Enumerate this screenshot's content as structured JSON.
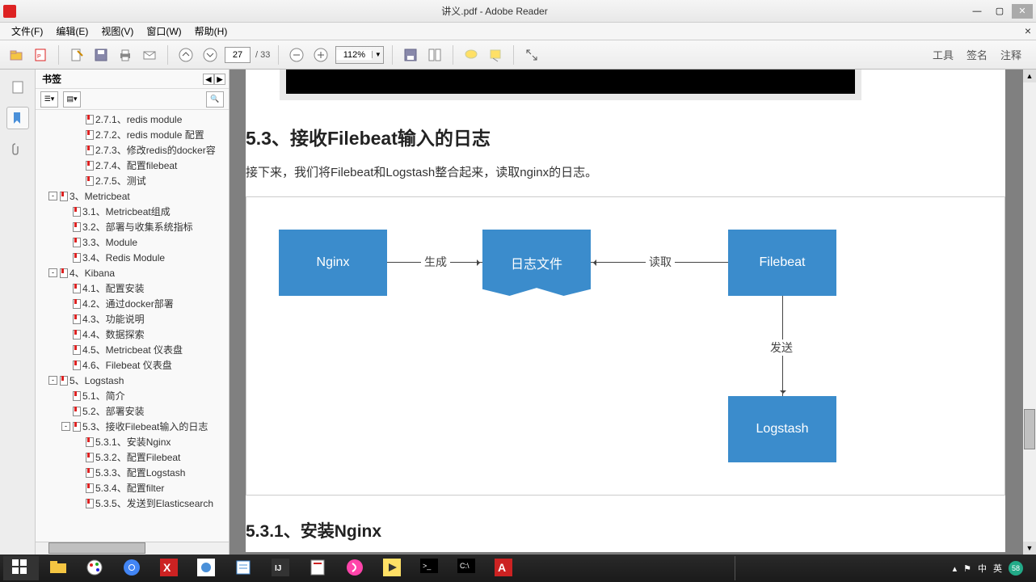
{
  "window": {
    "title": "讲义.pdf - Adobe Reader"
  },
  "menu": {
    "file": "文件(F)",
    "edit": "编辑(E)",
    "view": "视图(V)",
    "window": "窗口(W)",
    "help": "帮助(H)"
  },
  "toolbar": {
    "page_current": "27",
    "page_total": "/ 33",
    "zoom": "112%",
    "tools": "工具",
    "sign": "签名",
    "comment": "注释"
  },
  "sidebar": {
    "title": "书签"
  },
  "bookmarks": [
    {
      "indent": 3,
      "label": "2.7.1、redis module",
      "toggle": ""
    },
    {
      "indent": 3,
      "label": "2.7.2、redis module 配置",
      "toggle": ""
    },
    {
      "indent": 3,
      "label": "2.7.3、修改redis的docker容",
      "toggle": ""
    },
    {
      "indent": 3,
      "label": "2.7.4、配置filebeat",
      "toggle": ""
    },
    {
      "indent": 3,
      "label": "2.7.5、测试",
      "toggle": ""
    },
    {
      "indent": 1,
      "label": "3、Metricbeat",
      "toggle": "-"
    },
    {
      "indent": 2,
      "label": "3.1、Metricbeat组成",
      "toggle": ""
    },
    {
      "indent": 2,
      "label": "3.2、部署与收集系统指标",
      "toggle": ""
    },
    {
      "indent": 2,
      "label": "3.3、Module",
      "toggle": ""
    },
    {
      "indent": 2,
      "label": "3.4、Redis Module",
      "toggle": ""
    },
    {
      "indent": 1,
      "label": "4、Kibana",
      "toggle": "-"
    },
    {
      "indent": 2,
      "label": "4.1、配置安装",
      "toggle": ""
    },
    {
      "indent": 2,
      "label": "4.2、通过docker部署",
      "toggle": ""
    },
    {
      "indent": 2,
      "label": "4.3、功能说明",
      "toggle": ""
    },
    {
      "indent": 2,
      "label": "4.4、数据探索",
      "toggle": ""
    },
    {
      "indent": 2,
      "label": "4.5、Metricbeat 仪表盘",
      "toggle": ""
    },
    {
      "indent": 2,
      "label": "4.6、Filebeat 仪表盘",
      "toggle": ""
    },
    {
      "indent": 1,
      "label": "5、Logstash",
      "toggle": "-"
    },
    {
      "indent": 2,
      "label": "5.1、简介",
      "toggle": ""
    },
    {
      "indent": 2,
      "label": "5.2、部署安装",
      "toggle": ""
    },
    {
      "indent": 2,
      "label": "5.3、接收Filebeat输入的日志",
      "toggle": "-"
    },
    {
      "indent": 3,
      "label": "5.3.1、安装Nginx",
      "toggle": ""
    },
    {
      "indent": 3,
      "label": "5.3.2、配置Filebeat",
      "toggle": ""
    },
    {
      "indent": 3,
      "label": "5.3.3、配置Logstash",
      "toggle": ""
    },
    {
      "indent": 3,
      "label": "5.3.4、配置filter",
      "toggle": ""
    },
    {
      "indent": 3,
      "label": "5.3.5、发送到Elasticsearch",
      "toggle": ""
    }
  ],
  "content": {
    "h2": "5.3、接收Filebeat输入的日志",
    "p1": "接下来，我们将Filebeat和Logstash整合起来，读取nginx的日志。",
    "h3": "5.3.1、安装Nginx",
    "diagram": {
      "nginx": "Nginx",
      "logfile": "日志文件",
      "filebeat": "Filebeat",
      "logstash": "Logstash",
      "gen": "生成",
      "read": "读取",
      "send": "发送"
    }
  },
  "tray": {
    "ime1": "中",
    "ime2": "英",
    "badge": "58"
  }
}
